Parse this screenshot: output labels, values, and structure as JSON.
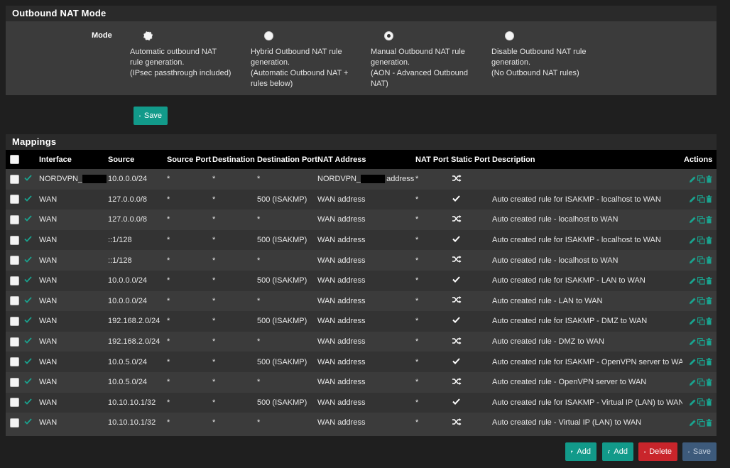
{
  "outbound_nat_mode": {
    "title": "Outbound NAT Mode",
    "mode_label": "Mode",
    "options": [
      {
        "lines": [
          "Automatic outbound NAT",
          "rule generation.",
          "(IPsec passthrough included)"
        ],
        "selected": false
      },
      {
        "lines": [
          "Hybrid Outbound NAT rule",
          "generation.",
          "(Automatic Outbound NAT +",
          "rules below)"
        ],
        "selected": false
      },
      {
        "lines": [
          "Manual Outbound NAT rule",
          "generation.",
          "(AON - Advanced Outbound",
          "NAT)"
        ],
        "selected": true
      },
      {
        "lines": [
          "Disable Outbound NAT rule",
          "generation.",
          "(No Outbound NAT rules)"
        ],
        "selected": false
      }
    ],
    "save_label": "Save"
  },
  "mappings": {
    "title": "Mappings",
    "columns": [
      "Interface",
      "Source",
      "Source Port",
      "Destination",
      "Destination Port",
      "NAT Address",
      "NAT Port",
      "Static Port",
      "Description",
      "Actions"
    ],
    "rows": [
      {
        "interface": "NORDVPN_",
        "source": "10.0.0.0/24",
        "source_port": "*",
        "destination": "*",
        "destination_port": "*",
        "nat_address": "NORDVPN_",
        "nat_address_suffix": "address",
        "nat_port": "*",
        "static_port": "shuffle",
        "description": "",
        "redacted": true
      },
      {
        "interface": "WAN",
        "source": "127.0.0.0/8",
        "source_port": "*",
        "destination": "*",
        "destination_port": "500 (ISAKMP)",
        "nat_address": "WAN address",
        "nat_port": "*",
        "static_port": "check",
        "description": "Auto created rule for ISAKMP - localhost to WAN"
      },
      {
        "interface": "WAN",
        "source": "127.0.0.0/8",
        "source_port": "*",
        "destination": "*",
        "destination_port": "*",
        "nat_address": "WAN address",
        "nat_port": "*",
        "static_port": "shuffle",
        "description": "Auto created rule - localhost to WAN"
      },
      {
        "interface": "WAN",
        "source": "::1/128",
        "source_port": "*",
        "destination": "*",
        "destination_port": "500 (ISAKMP)",
        "nat_address": "WAN address",
        "nat_port": "*",
        "static_port": "check",
        "description": "Auto created rule for ISAKMP - localhost to WAN"
      },
      {
        "interface": "WAN",
        "source": "::1/128",
        "source_port": "*",
        "destination": "*",
        "destination_port": "*",
        "nat_address": "WAN address",
        "nat_port": "*",
        "static_port": "shuffle",
        "description": "Auto created rule - localhost to WAN"
      },
      {
        "interface": "WAN",
        "source": "10.0.0.0/24",
        "source_port": "*",
        "destination": "*",
        "destination_port": "500 (ISAKMP)",
        "nat_address": "WAN address",
        "nat_port": "*",
        "static_port": "check",
        "description": "Auto created rule for ISAKMP - LAN to WAN"
      },
      {
        "interface": "WAN",
        "source": "10.0.0.0/24",
        "source_port": "*",
        "destination": "*",
        "destination_port": "*",
        "nat_address": "WAN address",
        "nat_port": "*",
        "static_port": "shuffle",
        "description": "Auto created rule - LAN to WAN"
      },
      {
        "interface": "WAN",
        "source": "192.168.2.0/24",
        "source_port": "*",
        "destination": "*",
        "destination_port": "500 (ISAKMP)",
        "nat_address": "WAN address",
        "nat_port": "*",
        "static_port": "check",
        "description": "Auto created rule for ISAKMP - DMZ to WAN"
      },
      {
        "interface": "WAN",
        "source": "192.168.2.0/24",
        "source_port": "*",
        "destination": "*",
        "destination_port": "*",
        "nat_address": "WAN address",
        "nat_port": "*",
        "static_port": "shuffle",
        "description": "Auto created rule - DMZ to WAN"
      },
      {
        "interface": "WAN",
        "source": "10.0.5.0/24",
        "source_port": "*",
        "destination": "*",
        "destination_port": "500 (ISAKMP)",
        "nat_address": "WAN address",
        "nat_port": "*",
        "static_port": "check",
        "description": "Auto created rule for ISAKMP - OpenVPN server to WAN"
      },
      {
        "interface": "WAN",
        "source": "10.0.5.0/24",
        "source_port": "*",
        "destination": "*",
        "destination_port": "*",
        "nat_address": "WAN address",
        "nat_port": "*",
        "static_port": "shuffle",
        "description": "Auto created rule - OpenVPN server to WAN"
      },
      {
        "interface": "WAN",
        "source": "10.10.10.1/32",
        "source_port": "*",
        "destination": "*",
        "destination_port": "500 (ISAKMP)",
        "nat_address": "WAN address",
        "nat_port": "*",
        "static_port": "check",
        "description": "Auto created rule for ISAKMP - Virtual IP (LAN) to WAN"
      },
      {
        "interface": "WAN",
        "source": "10.10.10.1/32",
        "source_port": "*",
        "destination": "*",
        "destination_port": "*",
        "nat_address": "WAN address",
        "nat_port": "*",
        "static_port": "shuffle",
        "description": "Auto created rule - Virtual IP (LAN) to WAN"
      }
    ]
  },
  "footer": {
    "add_top_label": "Add",
    "add_bottom_label": "Add",
    "delete_label": "Delete",
    "save_label": "Save"
  },
  "colors": {
    "accent_green": "#129a8a",
    "enabled_check": "#1aa38f",
    "danger": "#c9252b",
    "muted_primary": "#3d5a7b"
  }
}
